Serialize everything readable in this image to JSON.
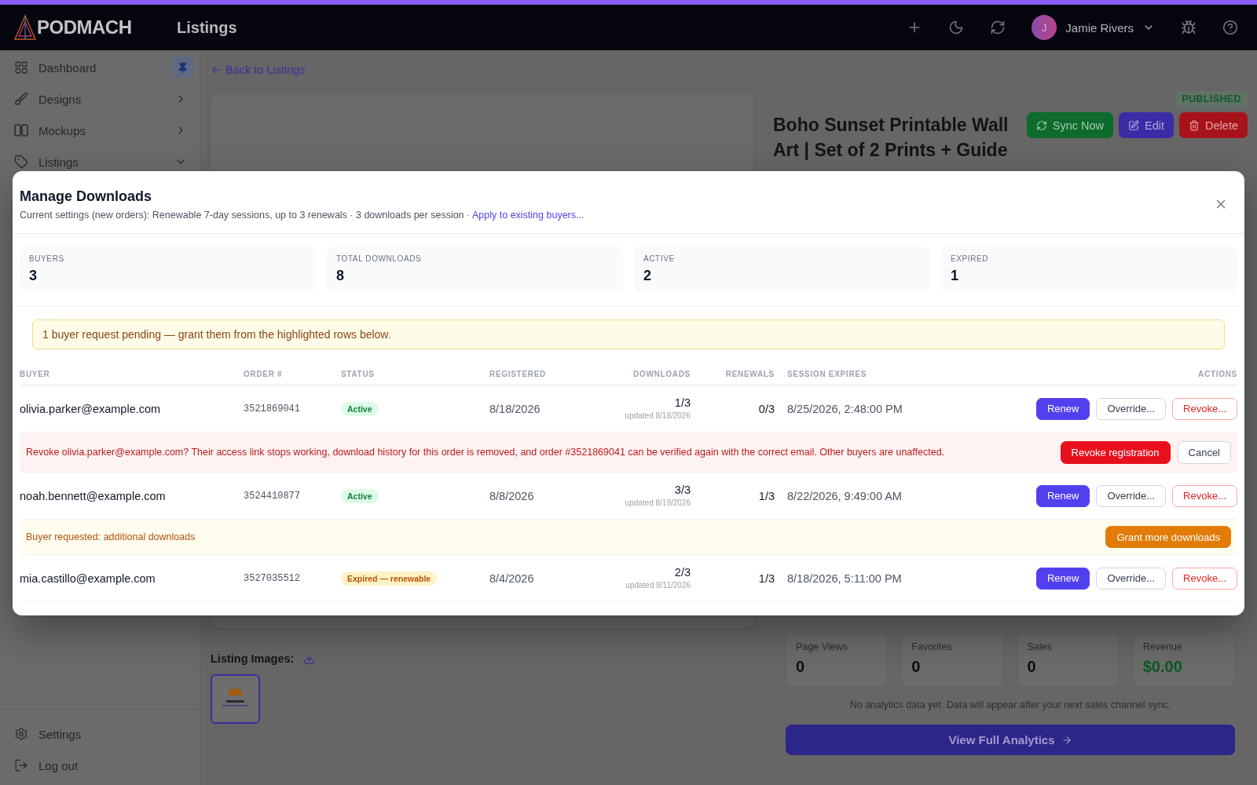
{
  "header": {
    "logo": "PODMACH",
    "title": "Listings",
    "user": {
      "initial": "J",
      "name": "Jamie Rivers"
    }
  },
  "sidebar": {
    "items": [
      {
        "label": "Dashboard",
        "pinned": true
      },
      {
        "label": "Designs",
        "expanded": false
      },
      {
        "label": "Mockups",
        "expanded": false
      },
      {
        "label": "Listings",
        "expanded": true
      }
    ],
    "footer_items": [
      {
        "label": "Settings"
      },
      {
        "label": "Log out"
      }
    ]
  },
  "page": {
    "back_link": "Back to Listings",
    "listing": {
      "status": "PUBLISHED",
      "title": "Boho Sunset Printable Wall Art | Set of 2 Prints + Guide",
      "actions": [
        {
          "label": "Sync Now",
          "kind": "sync"
        },
        {
          "label": "Edit",
          "kind": "edit"
        },
        {
          "label": "Delete",
          "kind": "delete"
        }
      ]
    },
    "images": {
      "label": "Listing Images:"
    },
    "analytics": {
      "stats": [
        {
          "label": "Page Views",
          "value": "0",
          "kind": "count"
        },
        {
          "label": "Favorites",
          "value": "0",
          "kind": "count"
        },
        {
          "label": "Sales",
          "value": "0",
          "kind": "count"
        },
        {
          "label": "Revenue",
          "value": "$0.00",
          "kind": "money"
        }
      ],
      "note": "No analytics data yet. Data will appear after your next sales channel sync.",
      "button": "View Full Analytics"
    }
  },
  "dialog": {
    "title": "Manage Downloads",
    "settings": "Current settings (new orders): Renewable 7-day sessions, up to 3 renewals · 3 downloads per session ·",
    "link": "Apply to existing buyers...",
    "stats": [
      {
        "label": "BUYERS",
        "value": "3"
      },
      {
        "label": "TOTAL DOWNLOADS",
        "value": "8"
      },
      {
        "label": "ACTIVE",
        "value": "2"
      },
      {
        "label": "EXPIRED",
        "value": "1"
      }
    ],
    "banner": "1 buyer request pending — grant them from the highlighted rows below.",
    "columns": [
      "BUYER",
      "ORDER #",
      "STATUS",
      "REGISTERED",
      "DOWNLOADS",
      "RENEWALS",
      "SESSION EXPIRES",
      "ACTIONS"
    ],
    "rows": [
      {
        "kind": "buyer",
        "email": "olivia.parker@example.com",
        "order": "3521869041",
        "status": {
          "label": "Active",
          "kind": "active"
        },
        "registered": "8/18/2026",
        "downloads": "1/3",
        "downloads_updated": "updated 8/18/2026",
        "renewals": "0/3",
        "expires": "8/25/2026, 2:48:00 PM",
        "actions": [
          {
            "label": "Renew",
            "kind": "primary"
          },
          {
            "label": "Override...",
            "kind": "secondary"
          },
          {
            "label": "Revoke...",
            "kind": "danger"
          }
        ]
      },
      {
        "kind": "confirm",
        "text": "Revoke olivia.parker@example.com? Their access link stops working, download history for this order is removed, and order #3521869041 can be verified again with the correct email. Other buyers are unaffected.",
        "actions": [
          {
            "label": "Revoke registration",
            "kind": "danger_solid"
          },
          {
            "label": "Cancel",
            "kind": "secondary"
          }
        ]
      },
      {
        "kind": "buyer",
        "email": "noah.bennett@example.com",
        "order": "3524410877",
        "status": {
          "label": "Active",
          "kind": "active"
        },
        "registered": "8/8/2026",
        "downloads": "3/3",
        "downloads_updated": "updated 8/19/2026",
        "renewals": "1/3",
        "expires": "8/22/2026, 9:49:00 AM",
        "actions": [
          {
            "label": "Renew",
            "kind": "primary"
          },
          {
            "label": "Override...",
            "kind": "secondary"
          },
          {
            "label": "Revoke...",
            "kind": "danger"
          }
        ]
      },
      {
        "kind": "request",
        "text": "Buyer requested: additional downloads",
        "actions": [
          {
            "label": "Grant more downloads",
            "kind": "warning"
          }
        ]
      },
      {
        "kind": "buyer",
        "email": "mia.castillo@example.com",
        "order": "3527035512",
        "status": {
          "label": "Expired — renewable",
          "kind": "expired"
        },
        "registered": "8/4/2026",
        "downloads": "2/3",
        "downloads_updated": "updated 8/11/2026",
        "renewals": "1/3",
        "expires": "8/18/2026, 5:11:00 PM",
        "actions": [
          {
            "label": "Renew",
            "kind": "primary"
          },
          {
            "label": "Override...",
            "kind": "secondary"
          },
          {
            "label": "Revoke...",
            "kind": "danger"
          }
        ]
      }
    ]
  }
}
